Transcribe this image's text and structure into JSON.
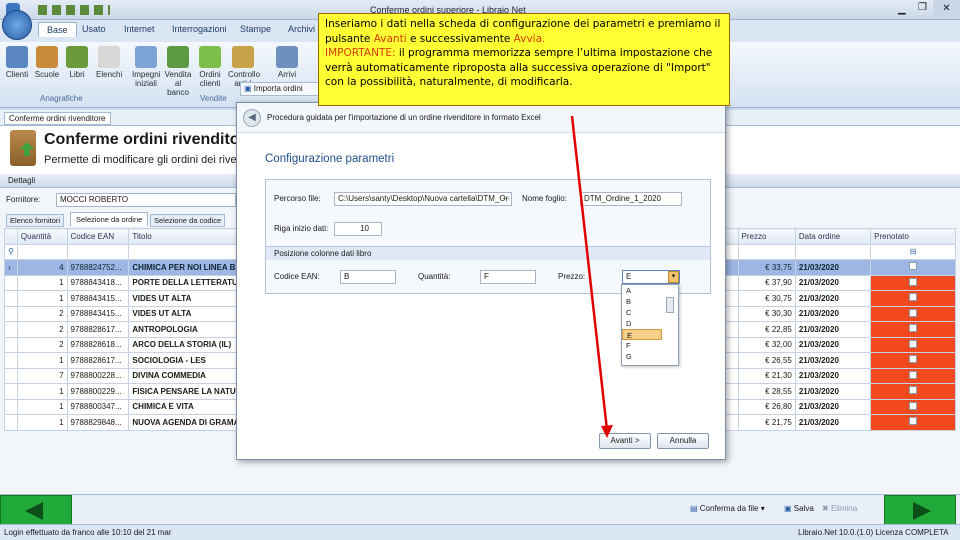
{
  "window": {
    "title": "Conferme ordini superiore - Libraio Net"
  },
  "ribbon": {
    "tabs": [
      "Base",
      "Usato",
      "Internet",
      "Interrogazioni",
      "Stampe",
      "Archivi"
    ],
    "buttons": [
      "Clienti",
      "Scuole",
      "Libri",
      "Elenchi",
      "Impegni iniziali",
      "Vendita al banco",
      "Ordini clienti",
      "Controllo arrivi",
      "Arrivi"
    ],
    "groups": [
      "Anagrafiche",
      "Vendite"
    ],
    "import_button": "Importa ordini"
  },
  "doc_tab": "Conferme ordini rivenditore",
  "header": {
    "title": "Conferme ordini rivenditore",
    "subtitle": "Permette di modificare gli ordini dei rivendit"
  },
  "form": {
    "section": "Dettagli",
    "fornitore_label": "Fornitore:",
    "fornitore_value": "MOCCI ROBERTO",
    "tabs": [
      "Elenco fornitori",
      "Selezione da ordine",
      "Selezione da codice"
    ]
  },
  "grid": {
    "columns": [
      "Quantità",
      "Codice EAN",
      "Titolo"
    ],
    "right_columns": [
      "Prezzo",
      "Data ordine",
      "Prenotato"
    ],
    "rows": [
      {
        "q": "4",
        "ean": "9788824752...",
        "title": "CHIMICA PER NOI LINEA B",
        "price": "€ 33,75",
        "date": "21/03/2020",
        "highlight": false
      },
      {
        "q": "1",
        "ean": "9788843418...",
        "title": "PORTE DELLA LETTERATUR",
        "price": "€ 37,90",
        "date": "21/03/2020",
        "highlight": true
      },
      {
        "q": "1",
        "ean": "9788843415...",
        "title": "VIDES UT ALTA",
        "price": "€ 30,75",
        "date": "21/03/2020",
        "highlight": true
      },
      {
        "q": "2",
        "ean": "9788843415...",
        "title": "VIDES UT ALTA",
        "price": "€ 30,30",
        "date": "21/03/2020",
        "highlight": true
      },
      {
        "q": "2",
        "ean": "9788828617...",
        "title": "ANTROPOLOGIA",
        "price": "€ 22,85",
        "date": "21/03/2020",
        "highlight": true
      },
      {
        "q": "2",
        "ean": "9788828618...",
        "title": "ARCO DELLA STORIA (IL)",
        "price": "€ 32,00",
        "date": "21/03/2020",
        "highlight": true
      },
      {
        "q": "1",
        "ean": "9788828617...",
        "title": "SOCIOLOGIA - LES",
        "price": "€ 26,55",
        "date": "21/03/2020",
        "highlight": true
      },
      {
        "q": "7",
        "ean": "9788800228...",
        "title": "DIVINA COMMEDIA",
        "price": "€ 21,30",
        "date": "21/03/2020",
        "highlight": true
      },
      {
        "q": "1",
        "ean": "9788800229...",
        "title": "FISICA PENSARE LA NATUR",
        "price": "€ 28,55",
        "date": "21/03/2020",
        "highlight": true
      },
      {
        "q": "1",
        "ean": "9788800347...",
        "title": "CHIMICA E VITA",
        "price": "€ 26,80",
        "date": "21/03/2020",
        "highlight": true
      },
      {
        "q": "1",
        "ean": "9788829848...",
        "title": "NUOVA AGENDA DI GRAMA",
        "price": "€ 21,75",
        "date": "21/03/2020",
        "highlight": true
      }
    ]
  },
  "dialog": {
    "title": "Procedura guidata per l'importazione di un ordine rivenditore in formato Excel",
    "heading": "Configurazione parametri",
    "percorso_label": "Percorso file:",
    "percorso_value": "C:\\Users\\santy\\Desktop\\Nuova cartella\\DTM_Or",
    "nome_foglio_label": "Nome foglio:",
    "nome_foglio_value": "DTM_Ordine_1_2020",
    "riga_label": "Riga inizio dati:",
    "riga_value": "10",
    "section": "Posizione colonne dati libro",
    "ean_label": "Codice EAN:",
    "ean_value": "B",
    "qta_label": "Quantità:",
    "qta_value": "F",
    "prezzo_label": "Prezzo:",
    "prezzo_value": "E",
    "dropdown_options": [
      "A",
      "B",
      "C",
      "D",
      "E",
      "F",
      "G"
    ],
    "avanti": "Avanti >",
    "annulla": "Annulla"
  },
  "callout": {
    "text1": "Inseriamo i dati nella scheda di configurazione dei parametri e premiamo il pulsante ",
    "avanti": "Avanti",
    "text2": " e successivamente ",
    "avvia": "Avvia.",
    "important": "IMPORTANTE:",
    "text3": " il programma memorizza sempre l’ultima impostazione che verrà automaticamente riproposta alla successiva operazione di \"Import\" con la possibilità, naturalmente, di modificarla."
  },
  "bottom": {
    "conferma": "Conferma da file",
    "salva": "Salva",
    "elimina": "Elimina"
  },
  "status": {
    "left": "Login effettuato da franco alle 10:10 del 21 mar",
    "right": "Libraio.Net 10.0.(1.0) Licenza COMPLETA"
  },
  "colors": {
    "accent": "#2a5ea8",
    "highlight": "#f24a1c",
    "callout": "#ffff33",
    "arrow": "#e00000",
    "nav": "#1faa3a"
  }
}
